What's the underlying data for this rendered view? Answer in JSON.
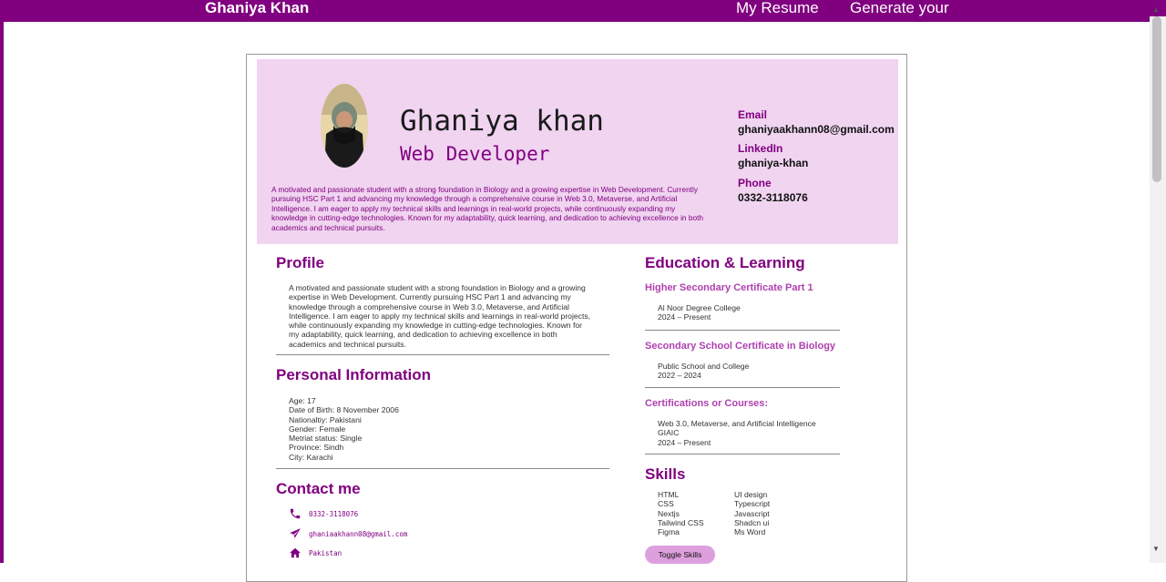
{
  "nav": {
    "brand": "Ghaniya Khan",
    "links": [
      "My Resume",
      "Generate your"
    ]
  },
  "resume": {
    "name": "Ghaniya khan",
    "title": "Web Developer",
    "summary": "A motivated and passionate student with a strong foundation in Biology and a growing expertise in Web Development. Currently pursuing HSC Part 1 and advancing my knowledge through a comprehensive course in Web 3.0, Metaverse, and Artificial Intelligence. I am eager to apply my technical skills and learnings in real-world projects, while continuously expanding my knowledge in cutting-edge technologies. Known for my adaptability, quick learning, and dedication to achieving excellence in both academics and technical pursuits.",
    "contact": [
      {
        "label": "Email",
        "value": "ghaniyaakhann08@gmail.com"
      },
      {
        "label": "LinkedIn",
        "value": "ghaniya-khan"
      },
      {
        "label": "Phone",
        "value": "0332-3118076"
      }
    ],
    "profile": {
      "heading": "Profile",
      "text": "A motivated and passionate student with a strong foundation in Biology and a growing expertise in Web Development. Currently pursuing HSC Part 1 and advancing my knowledge through a comprehensive course in Web 3.0, Metaverse, and Artificial Intelligence. I am eager to apply my technical skills and learnings in real-world projects, while continuously expanding my knowledge in cutting-edge technologies. Known for my adaptability, quick learning, and dedication to achieving excellence in both academics and technical pursuits."
    },
    "personal": {
      "heading": "Personal Information",
      "lines": [
        "Age: 17",
        "Date of Birth: 8 November 2006",
        "Nationaltiy: Pakistani",
        "Gender: Female",
        "Metriat status: Single",
        "Province: Sindh",
        "City: Karachi"
      ]
    },
    "contact_me": {
      "heading": "Contact me",
      "items": [
        {
          "icon": "phone-icon",
          "value": "0332-3118076"
        },
        {
          "icon": "paper-plane-icon",
          "value": "ghaniaakhann08@gmail.com"
        },
        {
          "icon": "home-icon",
          "value": "Pakistan"
        }
      ]
    },
    "education": {
      "heading": "Education & Learning",
      "entries": [
        {
          "title": "Higher Secondary Certificate Part 1",
          "lines": [
            "Al Noor Degree College",
            "2024 – Present"
          ]
        },
        {
          "title": "Secondary School Certificate in Biology",
          "lines": [
            "Public School and College",
            "2022 – 2024"
          ]
        },
        {
          "title": "Certifications or Courses:",
          "lines": [
            "Web 3.0, Metaverse, and Artificial Intelligence",
            "GIAIC",
            "2024 – Present"
          ]
        }
      ]
    },
    "skills": {
      "heading": "Skills",
      "col1": [
        "HTML",
        "CSS",
        "Nextjs",
        "Tailwind CSS",
        "Figma"
      ],
      "col2": [
        "UI design",
        "Typescript",
        "Javascript",
        "Shadcn ui",
        "Ms Word"
      ],
      "toggle_label": "Toggle Skills"
    }
  },
  "colors": {
    "accent": "#800080",
    "header_bg": "#f0d4f0",
    "button": "#dda0dd"
  }
}
